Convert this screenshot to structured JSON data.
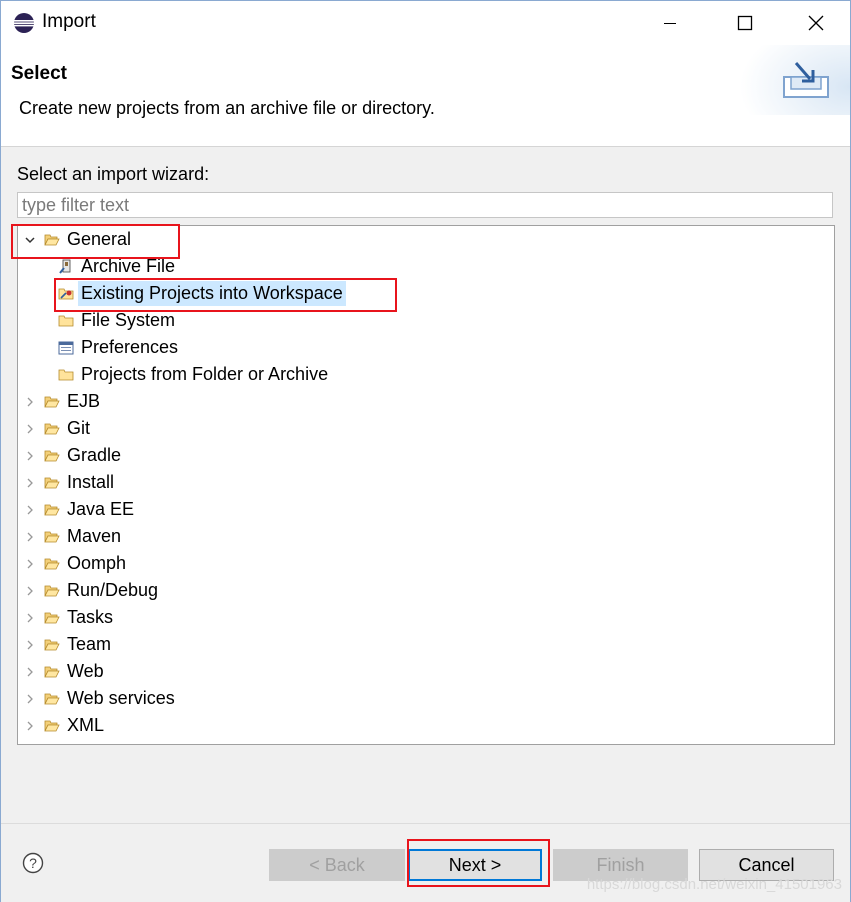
{
  "window": {
    "title": "Import",
    "minimize_icon": "minimize-icon",
    "maximize_icon": "maximize-icon",
    "close_icon": "close-icon"
  },
  "header": {
    "title": "Select",
    "description": "Create new projects from an archive file or directory."
  },
  "wizard": {
    "label": "Select an import wizard:",
    "filter_placeholder": "type filter text",
    "filter_value": "",
    "tree": [
      {
        "label": "General",
        "expanded": true,
        "level": 0,
        "icon": "folder-open-icon"
      },
      {
        "label": "Archive File",
        "level": 1,
        "icon": "archive-icon"
      },
      {
        "label": "Existing Projects into Workspace",
        "level": 1,
        "icon": "import-project-icon",
        "selected": true
      },
      {
        "label": "File System",
        "level": 1,
        "icon": "folder-icon"
      },
      {
        "label": "Preferences",
        "level": 1,
        "icon": "preferences-icon"
      },
      {
        "label": "Projects from Folder or Archive",
        "level": 1,
        "icon": "folder-icon"
      },
      {
        "label": "EJB",
        "level": 0,
        "icon": "folder-open-icon"
      },
      {
        "label": "Git",
        "level": 0,
        "icon": "folder-open-icon"
      },
      {
        "label": "Gradle",
        "level": 0,
        "icon": "folder-open-icon"
      },
      {
        "label": "Install",
        "level": 0,
        "icon": "folder-open-icon"
      },
      {
        "label": "Java EE",
        "level": 0,
        "icon": "folder-open-icon"
      },
      {
        "label": "Maven",
        "level": 0,
        "icon": "folder-open-icon"
      },
      {
        "label": "Oomph",
        "level": 0,
        "icon": "folder-open-icon"
      },
      {
        "label": "Run/Debug",
        "level": 0,
        "icon": "folder-open-icon"
      },
      {
        "label": "Tasks",
        "level": 0,
        "icon": "folder-open-icon"
      },
      {
        "label": "Team",
        "level": 0,
        "icon": "folder-open-icon"
      },
      {
        "label": "Web",
        "level": 0,
        "icon": "folder-open-icon"
      },
      {
        "label": "Web services",
        "level": 0,
        "icon": "folder-open-icon"
      },
      {
        "label": "XML",
        "level": 0,
        "icon": "folder-open-icon"
      }
    ]
  },
  "footer": {
    "help_icon": "help-icon",
    "back_label": "< Back",
    "next_label": "Next >",
    "finish_label": "Finish",
    "cancel_label": "Cancel"
  },
  "watermark": "https://blog.csdn.net/weixin_41501963",
  "colors": {
    "selection": "#cce8ff",
    "highlight_box": "#e8141c",
    "default_button_border": "#0078d7"
  }
}
